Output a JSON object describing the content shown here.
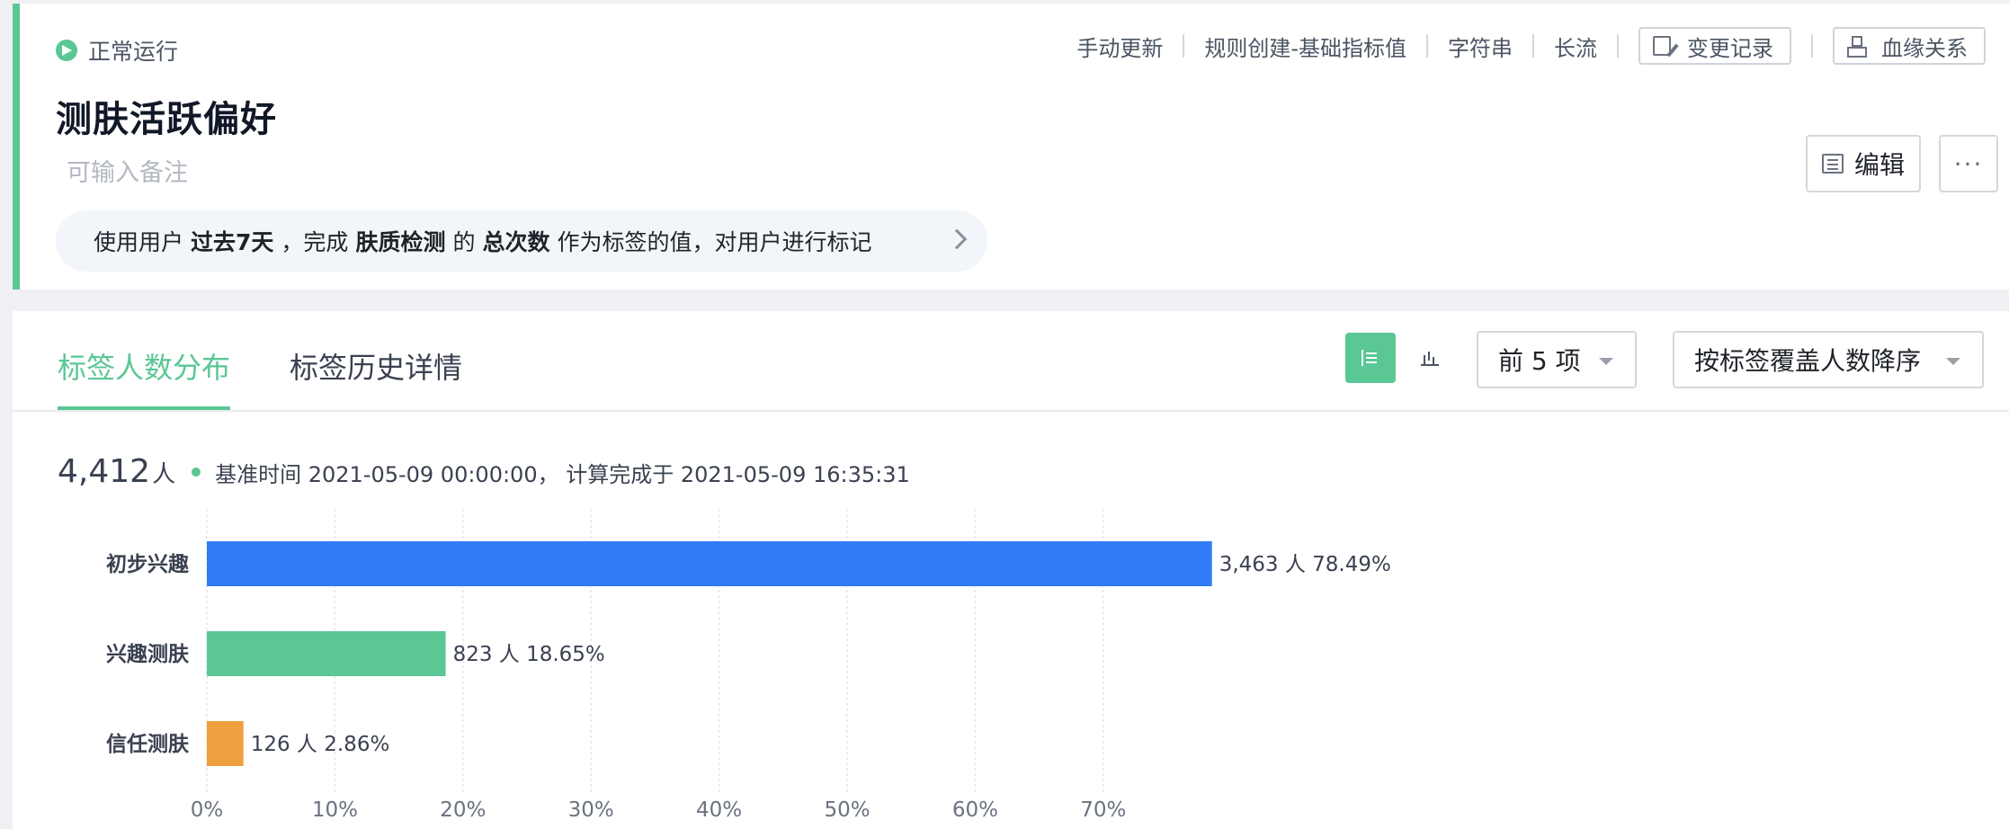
{
  "header": {
    "status_label": "正常运行",
    "meta_items": [
      "手动更新",
      "规则创建-基础指标值",
      "字符串",
      "长流"
    ],
    "history_button": "变更记录",
    "lineage_button": "血缘关系",
    "title": "测肤活跃偏好",
    "remark_placeholder": "可输入备注",
    "edit_button": "编辑",
    "more_button": "···",
    "rule": {
      "prefix": "使用用户",
      "period": "过去7天",
      "mid1": "，完成",
      "event": "肤质检测",
      "mid2": "的",
      "metric": "总次数",
      "suffix": "作为标签的值，对用户进行标记"
    }
  },
  "tabs": [
    {
      "label": "标签人数分布",
      "active": true
    },
    {
      "label": "标签历史详情",
      "active": false
    }
  ],
  "controls": {
    "top_n": "前 5 项",
    "sort": "按标签覆盖人数降序"
  },
  "summary": {
    "count": "4,412",
    "unit": "人",
    "info": "基准时间 2021-05-09 00:00:00， 计算完成于 2021-05-09 16:35:31"
  },
  "colors": {
    "accent": "#5ac794",
    "bar1": "#2f7cf6",
    "bar2": "#5ac794",
    "bar3": "#ef9f3f"
  },
  "chart_data": {
    "type": "bar",
    "orientation": "horizontal",
    "categories": [
      "初步兴趣",
      "兴趣测肤",
      "信任测肤"
    ],
    "values": [
      78.49,
      18.65,
      2.86
    ],
    "counts": [
      "3,463",
      "823",
      "126"
    ],
    "data_labels": [
      "3,463 人 78.49%",
      "823 人 18.65%",
      "126 人 2.86%"
    ],
    "colors": [
      "#2f7cf6",
      "#5ac794",
      "#ef9f3f"
    ],
    "x_ticks": [
      "0%",
      "10%",
      "20%",
      "30%",
      "40%",
      "50%",
      "60%",
      "70%"
    ],
    "xlim": [
      0,
      80
    ],
    "grid": true
  }
}
